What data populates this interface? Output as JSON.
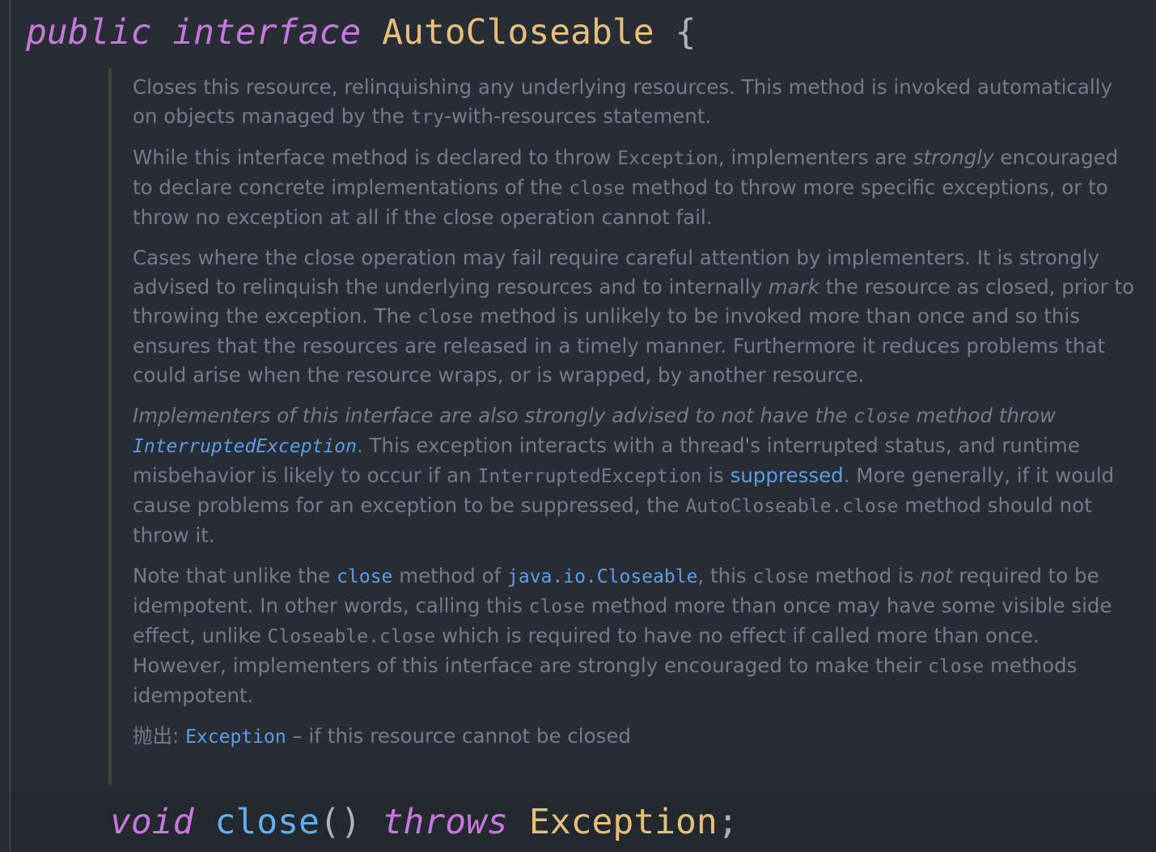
{
  "declaration": {
    "kw_public": "public",
    "kw_interface": "interface",
    "name": "AutoCloseable",
    "brace": "{"
  },
  "doc": {
    "p1": {
      "t1": "Closes this resource, relinquishing any underlying resources. This method is invoked automatically on objects managed by the ",
      "code1": "try",
      "t2": "-with-resources statement."
    },
    "p2": {
      "t1": "While this interface method is declared to throw ",
      "code1": "Exception",
      "t2": ", implementers are ",
      "em1": "strongly",
      "t3": " encouraged to declare concrete implementations of the ",
      "code2": "close",
      "t4": " method to throw more specific exceptions, or to throw no exception at all if the close operation cannot fail."
    },
    "p3": {
      "t1": "Cases where the close operation may fail require careful attention by implementers. It is strongly advised to relinquish the underlying resources and to internally ",
      "em1": "mark",
      "t2": " the resource as closed, prior to throwing the exception. The ",
      "code1": "close",
      "t3": " method is unlikely to be invoked more than once and so this ensures that the resources are released in a timely manner. Furthermore it reduces problems that could arise when the resource wraps, or is wrapped, by another resource."
    },
    "p4": {
      "em1": "Implementers of this interface are also strongly advised to not have the ",
      "code1": "close",
      "em2": " method throw ",
      "link1": "InterruptedException",
      "t1": ". This exception interacts with a thread's interrupted status, and runtime misbehavior is likely to occur if an ",
      "code2": "InterruptedException",
      "t2": " is ",
      "link2": "suppressed",
      "t3": ". More generally, if it would cause problems for an exception to be suppressed, the ",
      "code3": "AutoCloseable.close",
      "t4": " method should not throw it."
    },
    "p5": {
      "t1": "Note that unlike the ",
      "link1": "close",
      "t2": " method of ",
      "link2": "java.io.Closeable",
      "t3": ", this ",
      "code1": "close",
      "t4": " method is ",
      "em1": "not",
      "t5": " required to be idempotent. In other words, calling this ",
      "code2": "close",
      "t6": " method more than once may have some visible side effect, unlike ",
      "code3": "Closeable.close",
      "t7": " which is required to have no effect if called more than once. However, implementers of this interface are strongly encouraged to make their ",
      "code4": "close",
      "t8": " methods idempotent."
    },
    "throws": {
      "label": "抛出:",
      "link": "Exception",
      "desc": " – if this resource cannot be closed"
    }
  },
  "method": {
    "kw_void": "void",
    "name": "close",
    "parens": "()",
    "kw_throws": "throws",
    "exception": "Exception",
    "semicolon": ";"
  },
  "colors": {
    "background": "#282c34",
    "keyword": "#c678dd",
    "type": "#e5c07b",
    "function": "#61afef",
    "doc_text": "#747c88",
    "link": "#5c9ee6"
  }
}
